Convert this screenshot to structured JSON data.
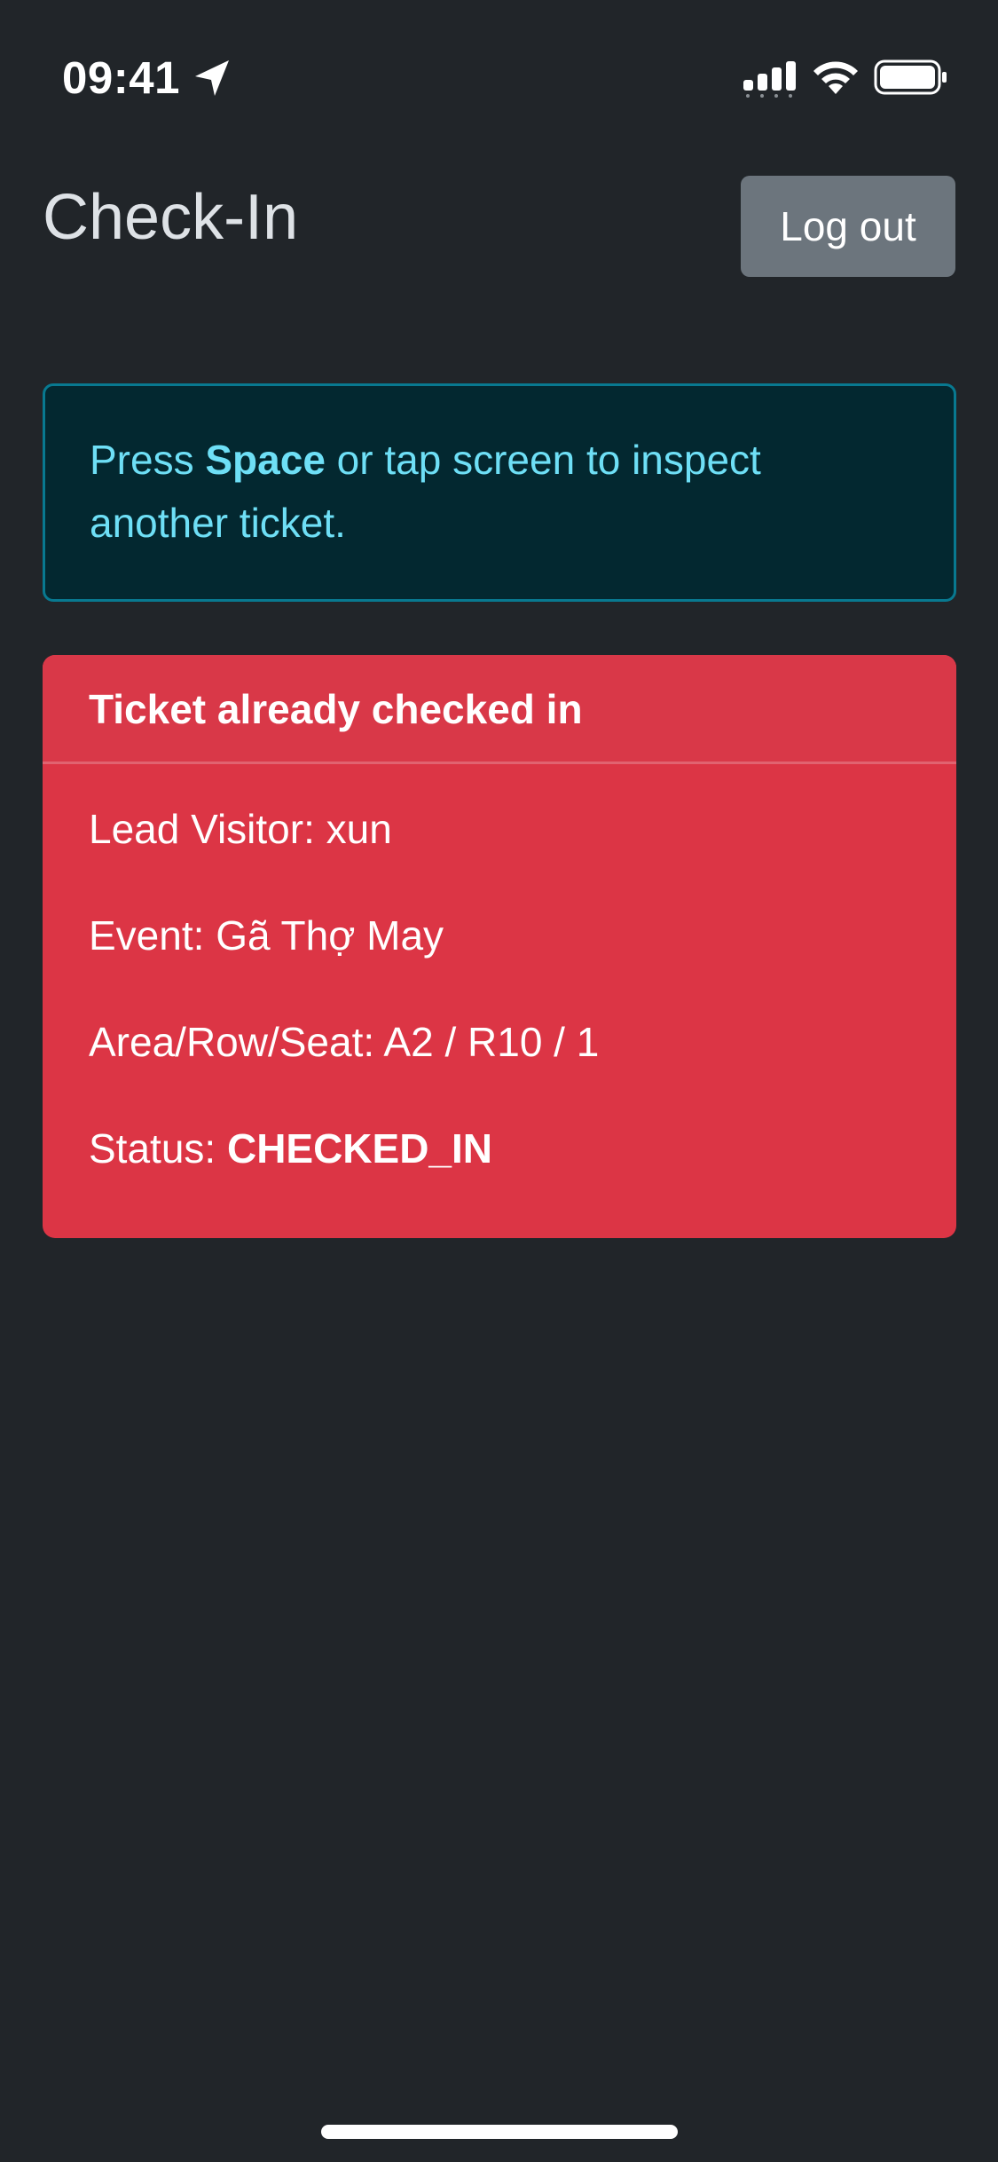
{
  "status_bar": {
    "time": "09:41",
    "icons": [
      "location-arrow-icon",
      "cellular-signal-icon",
      "wifi-icon",
      "battery-icon"
    ]
  },
  "header": {
    "title": "Check-In",
    "logout_label": "Log out"
  },
  "info_alert": {
    "prefix": "Press ",
    "key": "Space",
    "suffix": " or tap screen to inspect another ticket."
  },
  "ticket": {
    "heading": "Ticket already checked in",
    "lead_visitor_label": "Lead Visitor: ",
    "lead_visitor": "xun",
    "event_label": "Event: ",
    "event": "Gã Thợ May",
    "seat_label": "Area/Row/Seat: ",
    "seat": "A2 / R10 / 1",
    "status_label": "Status: ",
    "status": "CHECKED_IN"
  },
  "colors": {
    "background": "#212529",
    "alert_bg": "#032830",
    "alert_border": "#087990",
    "alert_text": "#6edff6",
    "danger": "#dc3545",
    "secondary_button": "#6c757d"
  }
}
